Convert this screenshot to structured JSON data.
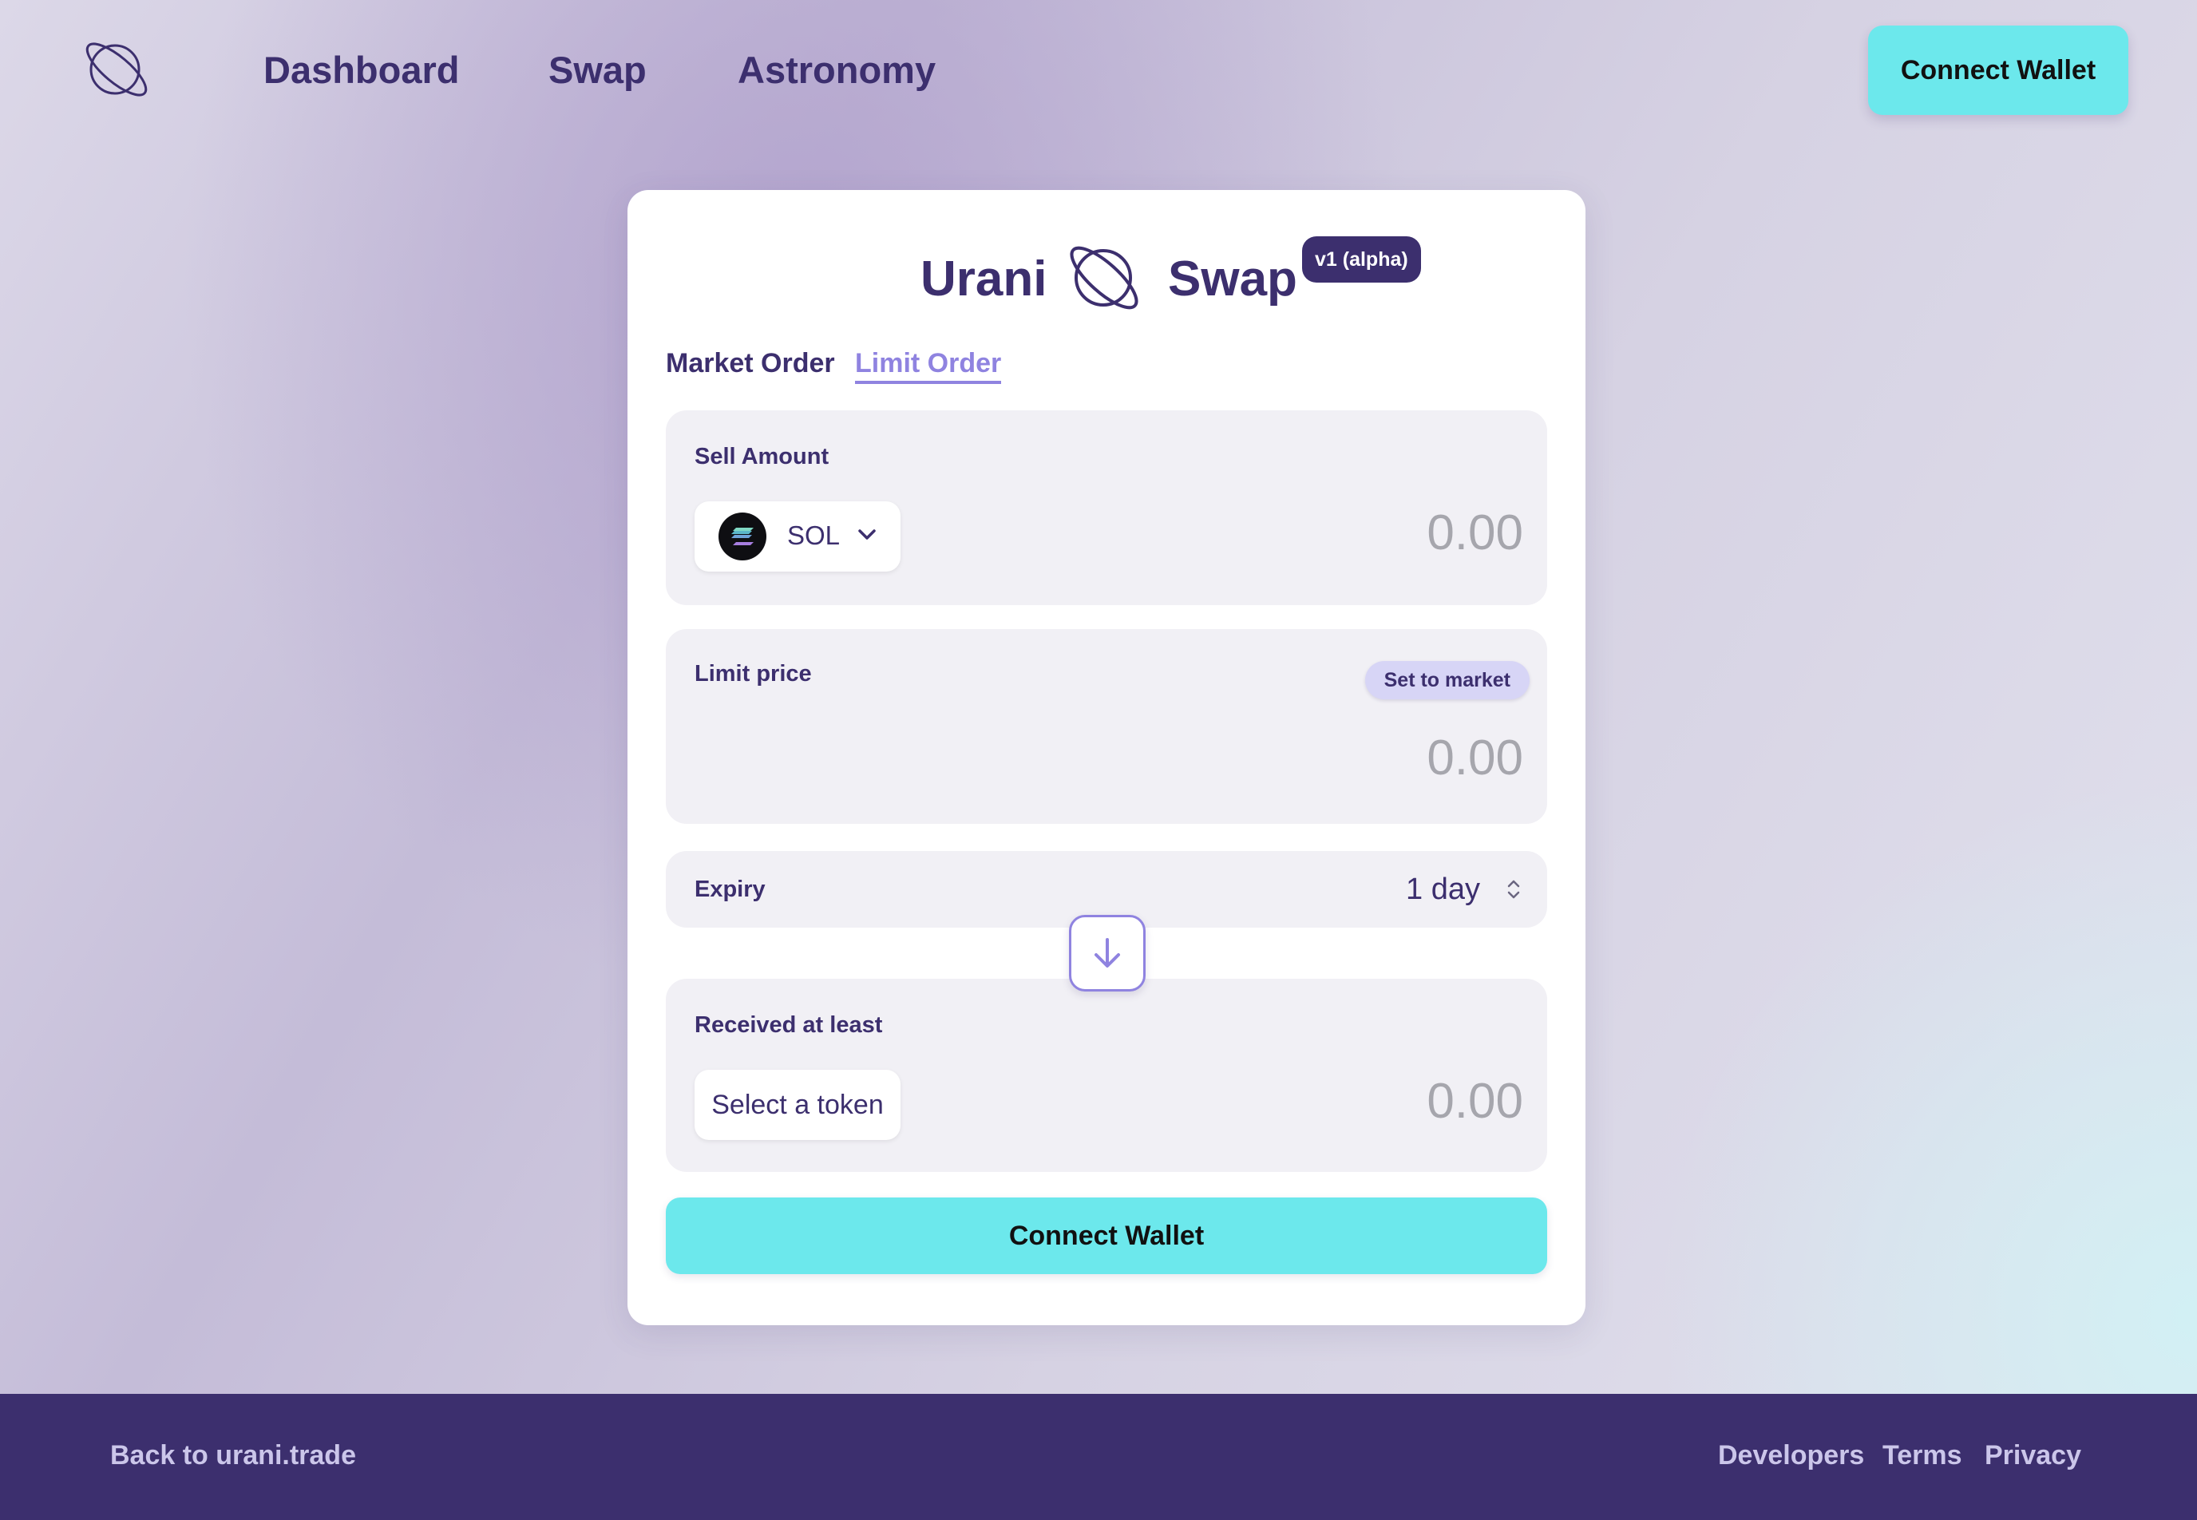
{
  "header": {
    "logo_icon": "planet-icon",
    "nav": [
      "Dashboard",
      "Swap",
      "Astronomy"
    ],
    "connect_button": "Connect Wallet"
  },
  "card": {
    "title_left": "Urani",
    "title_right": "Swap",
    "version_badge": "v1 (alpha)",
    "tabs": [
      {
        "label": "Market Order",
        "active": false
      },
      {
        "label": "Limit Order",
        "active": true
      }
    ],
    "sell": {
      "label": "Sell Amount",
      "token": "SOL",
      "amount_placeholder": "0.00"
    },
    "limit": {
      "label": "Limit price",
      "set_market_button": "Set to market",
      "amount_placeholder": "0.00"
    },
    "expiry": {
      "label": "Expiry",
      "value": "1 day"
    },
    "receive": {
      "label": "Received at least",
      "token_button": "Select a token",
      "amount_placeholder": "0.00"
    },
    "connect_button": "Connect Wallet"
  },
  "footer": {
    "back_link": "Back to urani.trade",
    "links": [
      "Developers",
      "Terms",
      "Privacy"
    ]
  },
  "colors": {
    "primary": "#3c2f6e",
    "accent_cyan": "#6ce8ec",
    "accent_purple": "#8f83e0",
    "panel": "#f1f0f5"
  }
}
